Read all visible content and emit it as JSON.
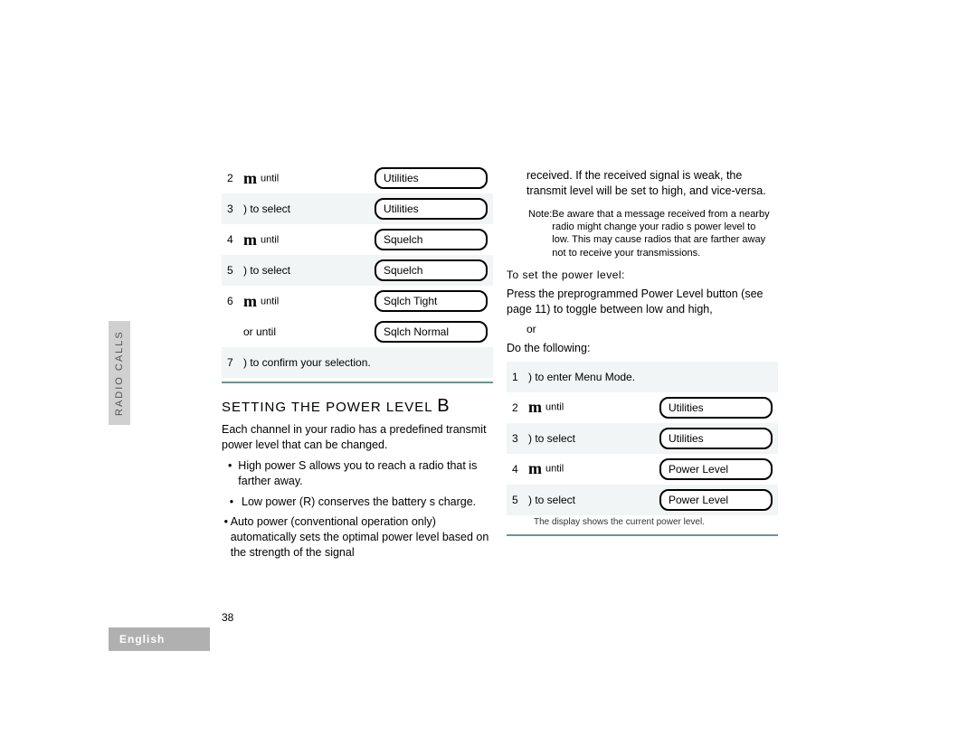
{
  "sideTab": "RADIO CALLS",
  "footer": "English",
  "pageNum": "38",
  "col1": {
    "rows": [
      {
        "n": "2",
        "icon": "m",
        "word": "until",
        "box": "Utilities",
        "shade": false
      },
      {
        "n": "3",
        "text": ")     to select",
        "box": "Utilities",
        "shade": true
      },
      {
        "n": "4",
        "icon": "m",
        "word": "until",
        "box": "Squelch",
        "shade": false
      },
      {
        "n": "5",
        "text": ")     to select",
        "box": "Squelch",
        "shade": true
      },
      {
        "n": "6",
        "icon": "m",
        "word": "until",
        "box": "Sqlch Tight",
        "shade": false
      },
      {
        "n": "",
        "text": "     or until",
        "box": "Sqlch Normal",
        "shade": false
      },
      {
        "n": "7",
        "text": ")     to confirm your selection.",
        "box": "",
        "shade": true
      }
    ],
    "sectionTitle": "SETTING THE POWER LEVEL",
    "sectionTag": "B",
    "p1": "Each channel in your radio has a predefined transmit power level that can be changed.",
    "b1": "High power  S  allows you to reach a radio that is farther away.",
    "b2": "Low power (R) conserves the battery s charge.",
    "b3": "Auto power (conventional operation only) automatically sets the optimal power level based on the strength of the signal"
  },
  "col2": {
    "topPara": "received. If the received signal is weak, the transmit level will be set to high, and vice-versa.",
    "noteLabel": "Note:",
    "noteText": "Be aware that a message received from a nearby radio might change your radio s power level to low. This may cause radios that are farther away not to receive your transmissions.",
    "sub": "To set the power level:",
    "p2": "Press the preprogrammed Power Level button (see page 11) to toggle between low and high,",
    "or": "or",
    "p3": "Do the following:",
    "rows": [
      {
        "n": "1",
        "text": ")     to enter Menu Mode.",
        "box": "",
        "shade": true
      },
      {
        "n": "2",
        "icon": "m",
        "word": "until",
        "box": "Utilities",
        "shade": false
      },
      {
        "n": "3",
        "text": ")     to select",
        "box": "Utilities",
        "shade": true
      },
      {
        "n": "4",
        "icon": "m",
        "word": "until",
        "box": "Power Level",
        "shade": false
      },
      {
        "n": "5",
        "text": ")     to select",
        "box": "Power Level",
        "shade": true
      }
    ],
    "tail": "The display shows the current power level."
  }
}
